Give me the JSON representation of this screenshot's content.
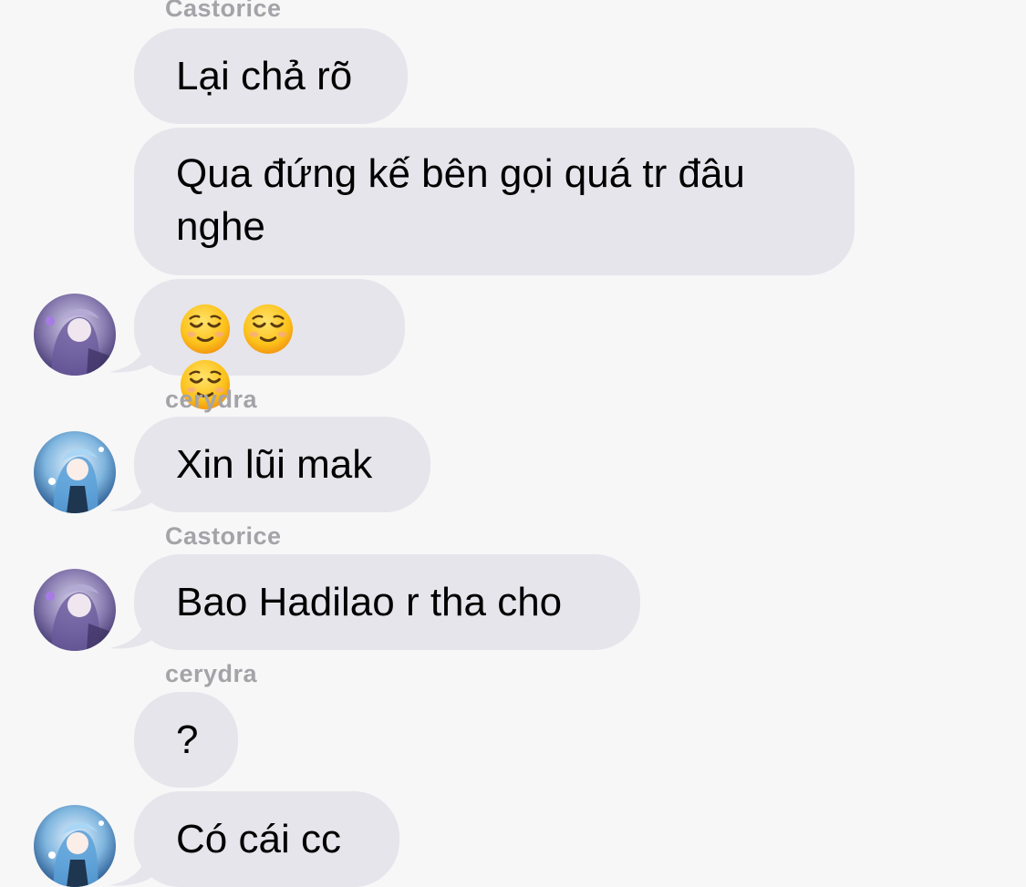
{
  "messages": [
    {
      "sender": "Castorice",
      "text": "Lại chả rõ"
    },
    {
      "text": "Qua đứng kế bên gọi quá tr đâu nghe"
    },
    {
      "emoji": [
        "relieved-face",
        "relieved-face",
        "relieved-face"
      ]
    },
    {
      "sender": "cerydra",
      "text": "Xin lũi mak"
    },
    {
      "sender": "Castorice",
      "text": "Bao Hadilao r tha cho"
    },
    {
      "sender": "cerydra",
      "text": "?"
    },
    {
      "text": "Có cái cc"
    }
  ],
  "avatars": {
    "castorice": "castorice-avatar",
    "cerydra": "cerydra-avatar"
  },
  "colors": {
    "background": "#f7f7f8",
    "bubble": "#e6e5eb",
    "sender": "#a4a4a8"
  }
}
